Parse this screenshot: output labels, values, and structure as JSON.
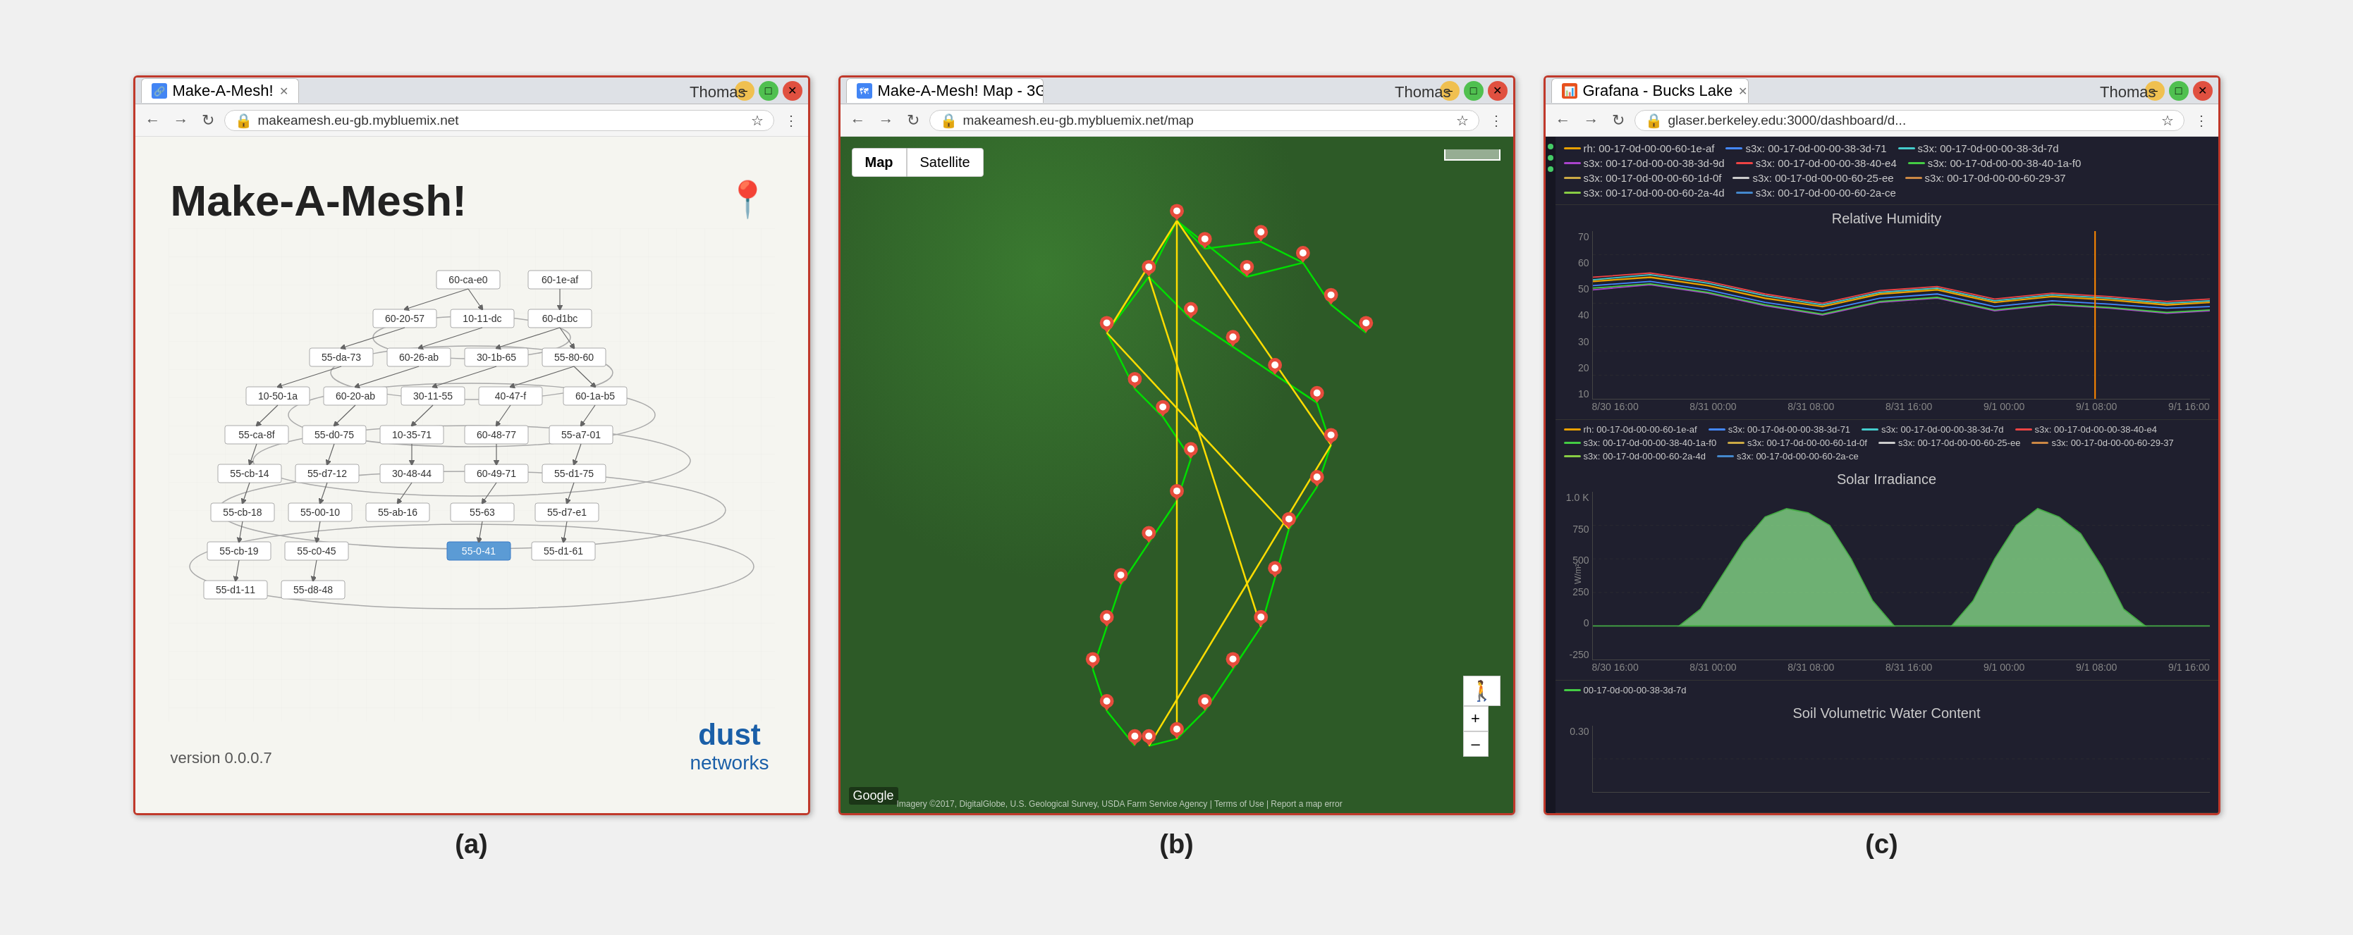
{
  "windows": {
    "a": {
      "tab_label": "Make-A-Mesh!",
      "tab_icon": "🔗",
      "user": "Thomas",
      "url": "makeamesh.eu-gb.mybluemix.net",
      "title": "Make-A-Mesh!",
      "version": "version 0.0.0.7",
      "logo_main": "dust",
      "logo_sub": "networks",
      "caption": "(a)"
    },
    "b": {
      "tab_label": "Make-A-Mesh! Map - 3G...",
      "tab_icon": "🗺",
      "user": "Thomas",
      "url": "makeamesh.eu-gb.mybluemix.net/map",
      "map_btn_1": "Map",
      "map_btn_2": "Satellite",
      "attribution": "Imagery ©2017, DigitalGlobe, U.S. Geological Survey, USDA Farm Service Agency | Terms of Use | Report a map error",
      "caption": "(b)"
    },
    "c": {
      "tab_label": "Grafana - Bucks Lake",
      "tab_icon": "📊",
      "user": "Thomas",
      "url": "glaser.berkeley.edu:3000/dashboard/d...",
      "legend_items": [
        {
          "color": "#e8a000",
          "label": "rh: 00-17-0d-00-00-60-1e-af"
        },
        {
          "color": "#4444cc",
          "label": "s3x: 00-17-0d-00-00-38-3d-71"
        },
        {
          "color": "#44aacc",
          "label": "s3x: 00-17-0d-00-00-38-3d-7d"
        },
        {
          "color": "#aa44cc",
          "label": "s3x: 00-17-0d-00-00-38-3d-9d"
        },
        {
          "color": "#cc4444",
          "label": "s3x: 00-17-0d-00-00-38-40-e4"
        },
        {
          "color": "#44cc44",
          "label": "s3x: 00-17-0d-00-00-38-40-e4"
        },
        {
          "color": "#ccaa44",
          "label": "s3x: 00-17-0d-00-00-60-1d-0f"
        },
        {
          "color": "#cccccc",
          "label": "s3x: 00-17-0d-00-00-60-25-ee"
        },
        {
          "color": "#cc8844",
          "label": "s3x: 00-17-0d-00-00-60-29-37"
        },
        {
          "color": "#88cc44",
          "label": "s3x: 00-17-0d-00-00-60-2a-4d"
        },
        {
          "color": "#4488cc",
          "label": "s3x: 00-17-0d-00-00-60-2a-ce"
        }
      ],
      "chart1": {
        "title": "Relative Humidity",
        "y_labels": [
          "70",
          "60",
          "50",
          "40",
          "30",
          "20",
          "10"
        ],
        "x_labels": [
          "8/30 16:00",
          "8/31 00:00",
          "8/31 08:00",
          "8/31 16:00",
          "9/1 00:00",
          "9/1 08:00",
          "9/1 16:00"
        ],
        "y_unit": "%"
      },
      "chart2": {
        "title": "Solar Irradiance",
        "y_labels": [
          "1.0 K",
          "750",
          "500",
          "250",
          "0",
          "-250"
        ],
        "x_labels": [
          "8/30 16:00",
          "8/31 00:00",
          "8/31 08:00",
          "8/31 16:00",
          "9/1 00:00",
          "9/1 08:00",
          "9/1 16:00"
        ],
        "y_unit": "W/m²",
        "legend_label": "00-17-0d-00-00-38-3d-7d"
      },
      "chart3": {
        "title": "Soil Volumetric Water Content",
        "y_labels": [
          "0.30"
        ],
        "x_labels": []
      },
      "caption": "(c)"
    }
  }
}
